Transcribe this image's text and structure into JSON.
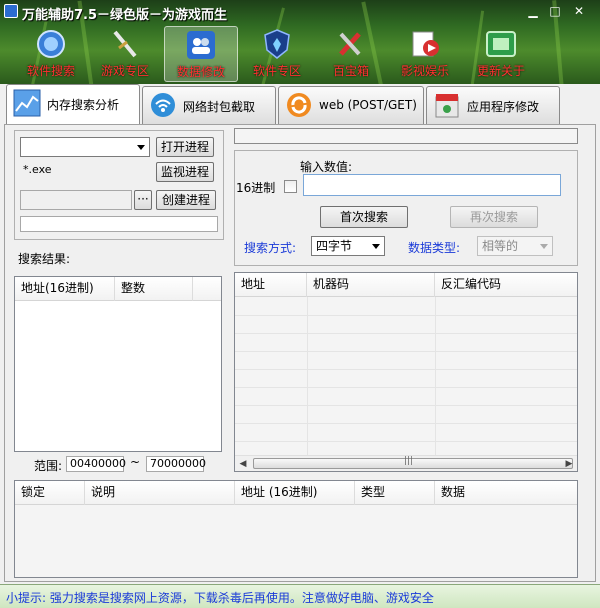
{
  "window": {
    "title": "万能辅助7.5－绿色版－为游戏而生",
    "controls": {
      "minimize": "▁",
      "maximize": "□",
      "close": "✕"
    }
  },
  "toolbar": [
    {
      "label": "软件搜索",
      "icon": "magnifier-icon",
      "active": false
    },
    {
      "label": "游戏专区",
      "icon": "sword-icon",
      "active": false
    },
    {
      "label": "数据修改",
      "icon": "users-icon",
      "active": true
    },
    {
      "label": "软件专区",
      "icon": "shield-icon",
      "active": false
    },
    {
      "label": "百宝箱",
      "icon": "tools-icon",
      "active": false
    },
    {
      "label": "影视娱乐",
      "icon": "media-icon",
      "active": false
    },
    {
      "label": "更新关于",
      "icon": "monitor-icon",
      "active": false
    }
  ],
  "tabs": [
    {
      "label": "内存搜索分析",
      "icon": "chart-icon",
      "active": true
    },
    {
      "label": "网络封包截取",
      "icon": "wifi-icon",
      "active": false
    },
    {
      "label": "web (POST/GET)",
      "icon": "refresh-icon",
      "active": false
    },
    {
      "label": "应用程序修改",
      "icon": "app-icon",
      "active": false
    }
  ],
  "process": {
    "selected": "",
    "open_button": "打开进程",
    "filter_value": "*.exe",
    "monitor_button": "监视进程",
    "path_value": "",
    "browse_button": "···",
    "create_button": "创建进程"
  },
  "results": {
    "label": "搜索结果:",
    "columns": [
      "地址(16进制)",
      "整数"
    ]
  },
  "range": {
    "label": "范围:",
    "from": "00400000",
    "sep": "~",
    "to": "70000000"
  },
  "search": {
    "input_label": "输入数值:",
    "hex_label": "16进制",
    "hex_checked": false,
    "value": "",
    "first_button": "首次搜索",
    "next_button": "再次搜索",
    "mode_label": "搜索方式:",
    "mode_value": "四字节",
    "type_label": "数据类型:",
    "type_value": "相等的"
  },
  "disasm": {
    "columns": [
      "地址",
      "机器码",
      "反汇编代码"
    ],
    "scroll_mark": "|||"
  },
  "locks": {
    "columns": [
      "锁定",
      "说明",
      "地址 (16进制)",
      "类型",
      "数据"
    ]
  },
  "status": "小提示: 强力搜索是搜索网上资源，下载杀毒后再使用。注意做好电脑、游戏安全",
  "colors": {
    "toolbar_label": "#ff3030",
    "status_text": "#1a3ad8",
    "header_green": "#2f6a22"
  }
}
